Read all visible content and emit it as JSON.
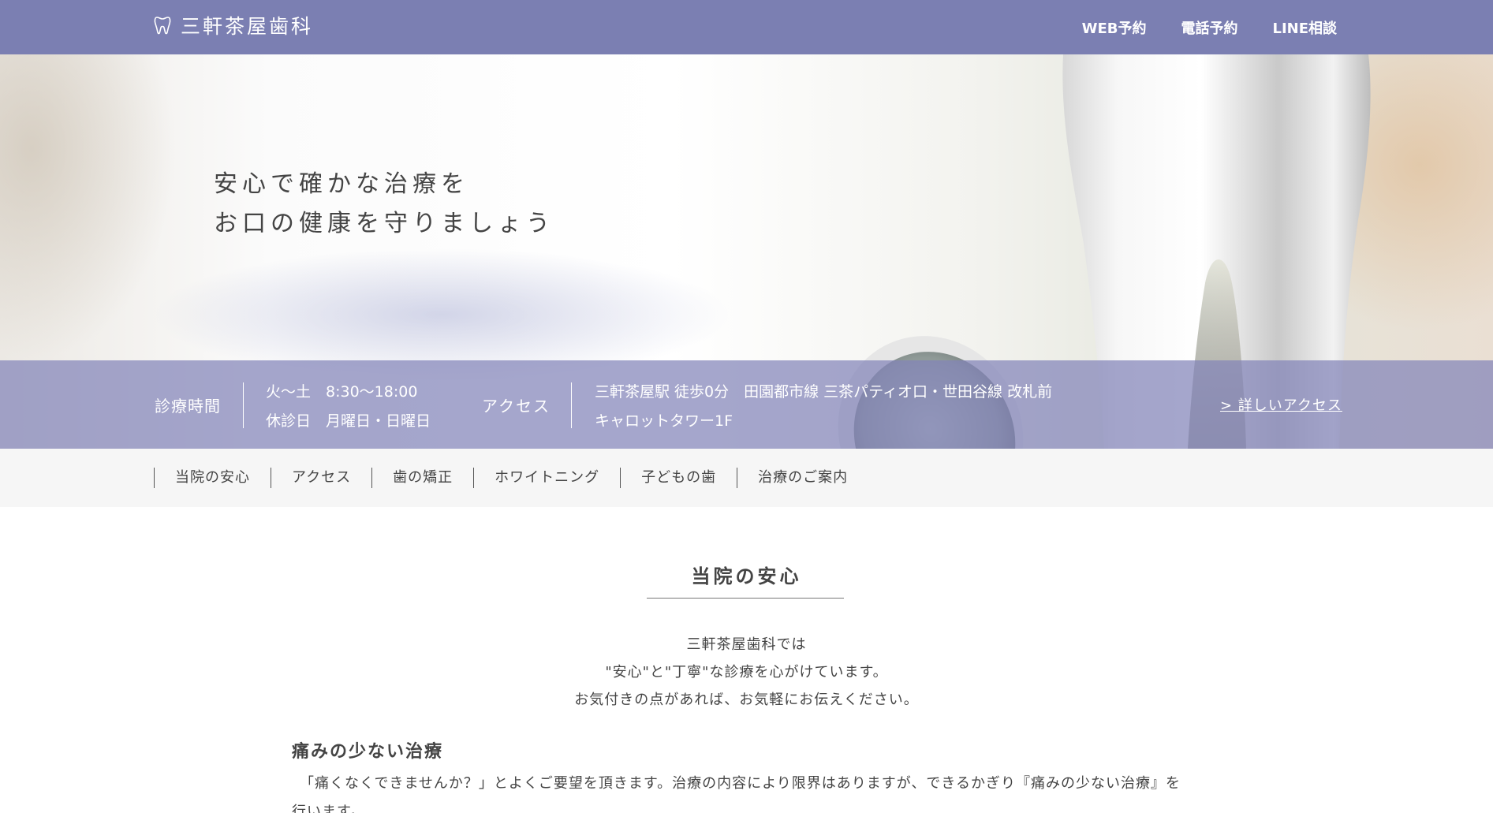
{
  "header": {
    "logo_text": "三軒茶屋歯科",
    "nav": [
      {
        "label": "WEB予約"
      },
      {
        "label": "電話予約"
      },
      {
        "label": "LINE相談"
      }
    ]
  },
  "hero": {
    "line1": "安心で確かな治療を",
    "line2": "お口の健康を守りましょう"
  },
  "info": {
    "hours_label": "診療時間",
    "hours_line1": "火〜土　8:30〜18:00",
    "hours_line2": "休診日　月曜日・日曜日",
    "access_label": "アクセス",
    "access_line1": "三軒茶屋駅 徒歩0分　田園都市線 三茶パティオ口・世田谷線 改札前",
    "access_line2": "キャロットタワー1F",
    "more_link": "> 詳しいアクセス"
  },
  "subnav": [
    {
      "label": "当院の安心"
    },
    {
      "label": "アクセス"
    },
    {
      "label": "歯の矯正"
    },
    {
      "label": "ホワイトニング"
    },
    {
      "label": "子どもの歯"
    },
    {
      "label": "治療のご案内"
    }
  ],
  "content": {
    "section_title": "当院の安心",
    "intro_line1": "三軒茶屋歯科では",
    "intro_line2": "\"安心\"と\"丁寧\"な診療を心がけています。",
    "intro_line3": "お気付きの点があれば、お気軽にお伝えください。",
    "subheading": "痛みの少ない治療",
    "paragraph": "　「痛くなくできませんか？」とよくご要望を頂きます。治療の内容により限界はありますが、できるかぎり『痛みの少ない治療』を行います。"
  },
  "colors": {
    "header_bg": "#7b7fb2",
    "info_band": "#8284b9",
    "subnav_bg": "#f6f6f6"
  }
}
